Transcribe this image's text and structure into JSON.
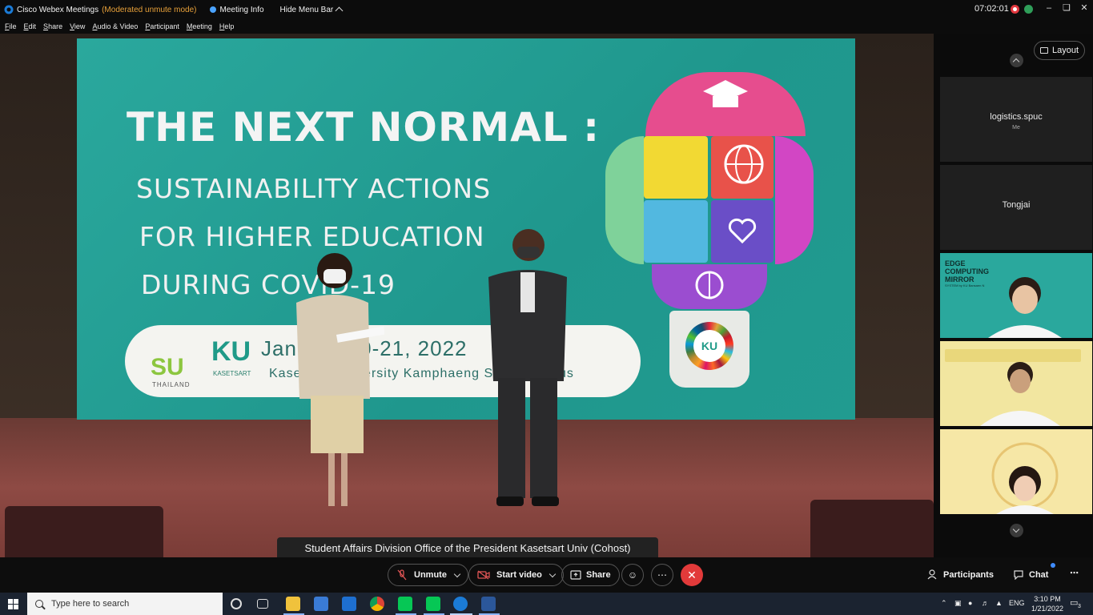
{
  "window": {
    "app_title": "Cisco Webex Meetings",
    "app_mode": "(Moderated unmute mode)",
    "meeting_info": "Meeting Info",
    "hide_menu": "Hide Menu Bar",
    "clock": "07:02:01"
  },
  "menu": [
    {
      "u": "F",
      "rest": "ile"
    },
    {
      "u": "E",
      "rest": "dit"
    },
    {
      "u": "S",
      "rest": "hare"
    },
    {
      "u": "V",
      "rest": "iew"
    },
    {
      "u": "A",
      "rest": "udio & Video"
    },
    {
      "u": "P",
      "rest": "articipant"
    },
    {
      "u": "M",
      "rest": "eeting"
    },
    {
      "u": "H",
      "rest": "elp"
    }
  ],
  "stage": {
    "slide_title": "THE NEXT NORMAL :",
    "line1": "SUSTAINABILITY ACTIONS",
    "line2": "FOR HIGHER EDUCATION",
    "line3": "DURING COVID-19",
    "su_logo": "SU",
    "su_sub": "THAILAND",
    "ku_logo": "KU",
    "ku_sub": "KASETSART",
    "date_text": "January 20-21, 2022",
    "place_text": "Kasetsart University Kamphaeng Saen Campus",
    "bulb_badge": "KU",
    "caption": "Student Affairs Division Office of the President Kasetsart Univ (Cohost)"
  },
  "panel": {
    "layout_label": "Layout",
    "tiles": [
      {
        "name": "logistics.spuc",
        "sub": "Me"
      },
      {
        "name": "Tongjai",
        "sub": ""
      },
      {
        "name": "EDGE COMPUTING MIRROR",
        "sub": "SYSTEM by KU Bansaen N"
      },
      {
        "name": "",
        "sub": ""
      },
      {
        "name": "",
        "sub": ""
      }
    ]
  },
  "controls": {
    "unmute": "Unmute",
    "start_video": "Start video",
    "share": "Share",
    "participants": "Participants",
    "chat": "Chat"
  },
  "taskbar": {
    "search_placeholder": "Type here to search",
    "lang": "ENG",
    "time": "3:10 PM",
    "date": "1/21/2022",
    "notif_count": "3"
  },
  "colors": {
    "slide_teal": "#219b90",
    "end_red": "#e23a3a",
    "mode_orange": "#e8a13a",
    "tile_green": "#2aa89d",
    "tile_yellow": "#f2e6a0"
  }
}
